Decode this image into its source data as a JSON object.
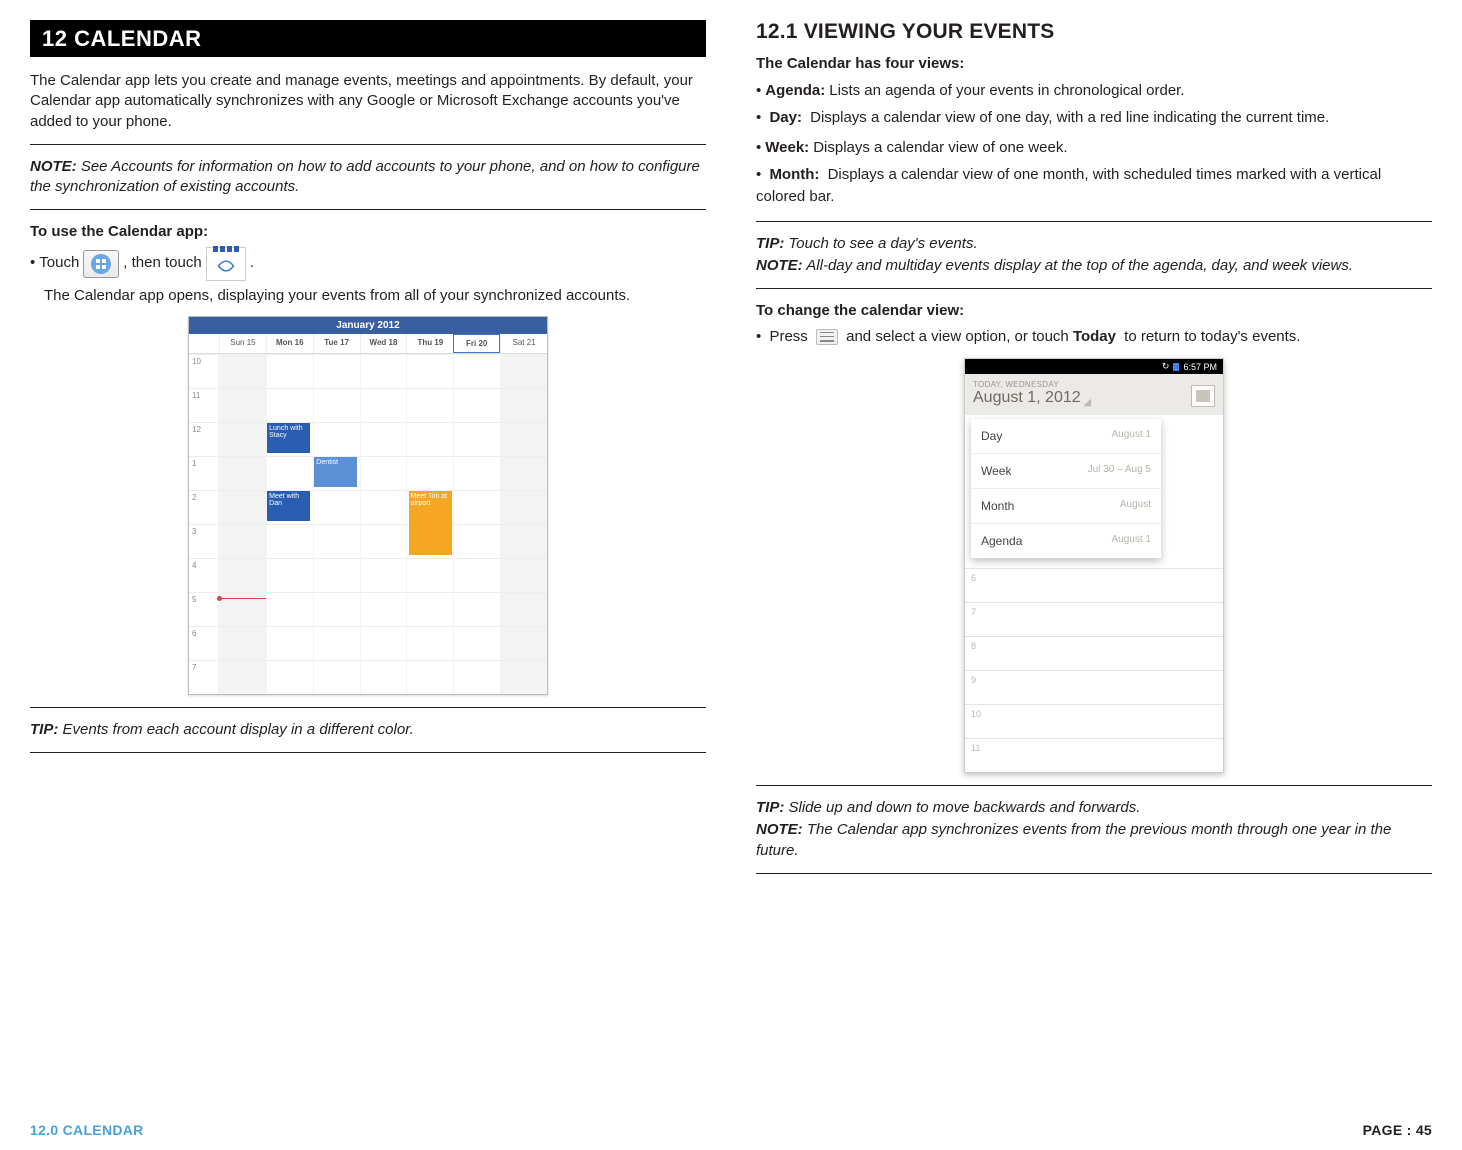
{
  "left": {
    "section_title": "12 CALENDAR",
    "intro": "The Calendar app lets you create and manage events, meetings and appointments. By default, your Calendar app automatically synchronizes with any Google or Microsoft Exchange accounts you've added to your phone.",
    "note_label": "NOTE:",
    "note_text": " See Accounts for information on how to add accounts to your phone, and on how to configure the synchronization of existing accounts.",
    "use_heading": "To use the Calendar app:",
    "touch_pre": "Touch ",
    "touch_mid": " , then touch ",
    "touch_post": " .",
    "opens_text": "The Calendar app opens, displaying your events from all of your synchronized accounts.",
    "tip_label": "TIP:",
    "tip_text": " Events from each account display in a different color."
  },
  "shot1": {
    "title": "January 2012",
    "days": [
      "",
      "Sun 15",
      "Mon 16",
      "Tue 17",
      "Wed 18",
      "Thu 19",
      "Fri 20",
      "Sat 21"
    ],
    "hours": [
      "10",
      "11",
      "12",
      "1",
      "2",
      "3",
      "4",
      "5",
      "6",
      "7"
    ],
    "ev_lunch": "Lunch with Stacy",
    "ev_meet": "Meet with Dan",
    "ev_dentist": "Dentist",
    "ev_tim": "Meet Tim at airport"
  },
  "right": {
    "subhead": "12.1 VIEWING YOUR EVENTS",
    "four_views": "The Calendar has four views:",
    "agenda_label": "Agenda:",
    "agenda_text": " Lists an agenda of your events in chronological order.",
    "day_label": "Day:",
    "day_text": " Displays a calendar view of one day, with a red line indicating the current time.",
    "week_label": "Week:",
    "week_text": " Displays a calendar view of one week.",
    "month_label": "Month:",
    "month_text": " Displays a calendar view of one month, with scheduled times marked with a vertical colored bar.",
    "tip1_label": "TIP:",
    "tip1_text": " Touch to see a day's events.",
    "note1_label": "NOTE:",
    "note1_text": " All-day and multiday events display at the top of the agenda, day, and week views.",
    "change_heading": "To change the calendar view:",
    "press_pre": "Press ",
    "press_mid": " and select a view option, or touch ",
    "press_today": "Today",
    "press_post": " to return to today's events.",
    "tip2_label": "TIP:",
    "tip2_text": " Slide up and down to move backwards and forwards.",
    "note2_label": "NOTE:",
    "note2_text": " The Calendar app synchronizes events from the previous month through one year in the future."
  },
  "shot2": {
    "time": "6:57 PM",
    "today_label": "TODAY, WEDNESDAY",
    "date": "August 1, 2012",
    "menu": [
      {
        "l": "Day",
        "r": "August 1"
      },
      {
        "l": "Week",
        "r": "Jul 30 – Aug 5"
      },
      {
        "l": "Month",
        "r": "August"
      },
      {
        "l": "Agenda",
        "r": "August 1"
      }
    ],
    "hours": [
      "6",
      "7",
      "8",
      "9",
      "10",
      "11"
    ]
  },
  "footer": {
    "left": "12.0 CALENDAR",
    "right": "PAGE : 45"
  }
}
